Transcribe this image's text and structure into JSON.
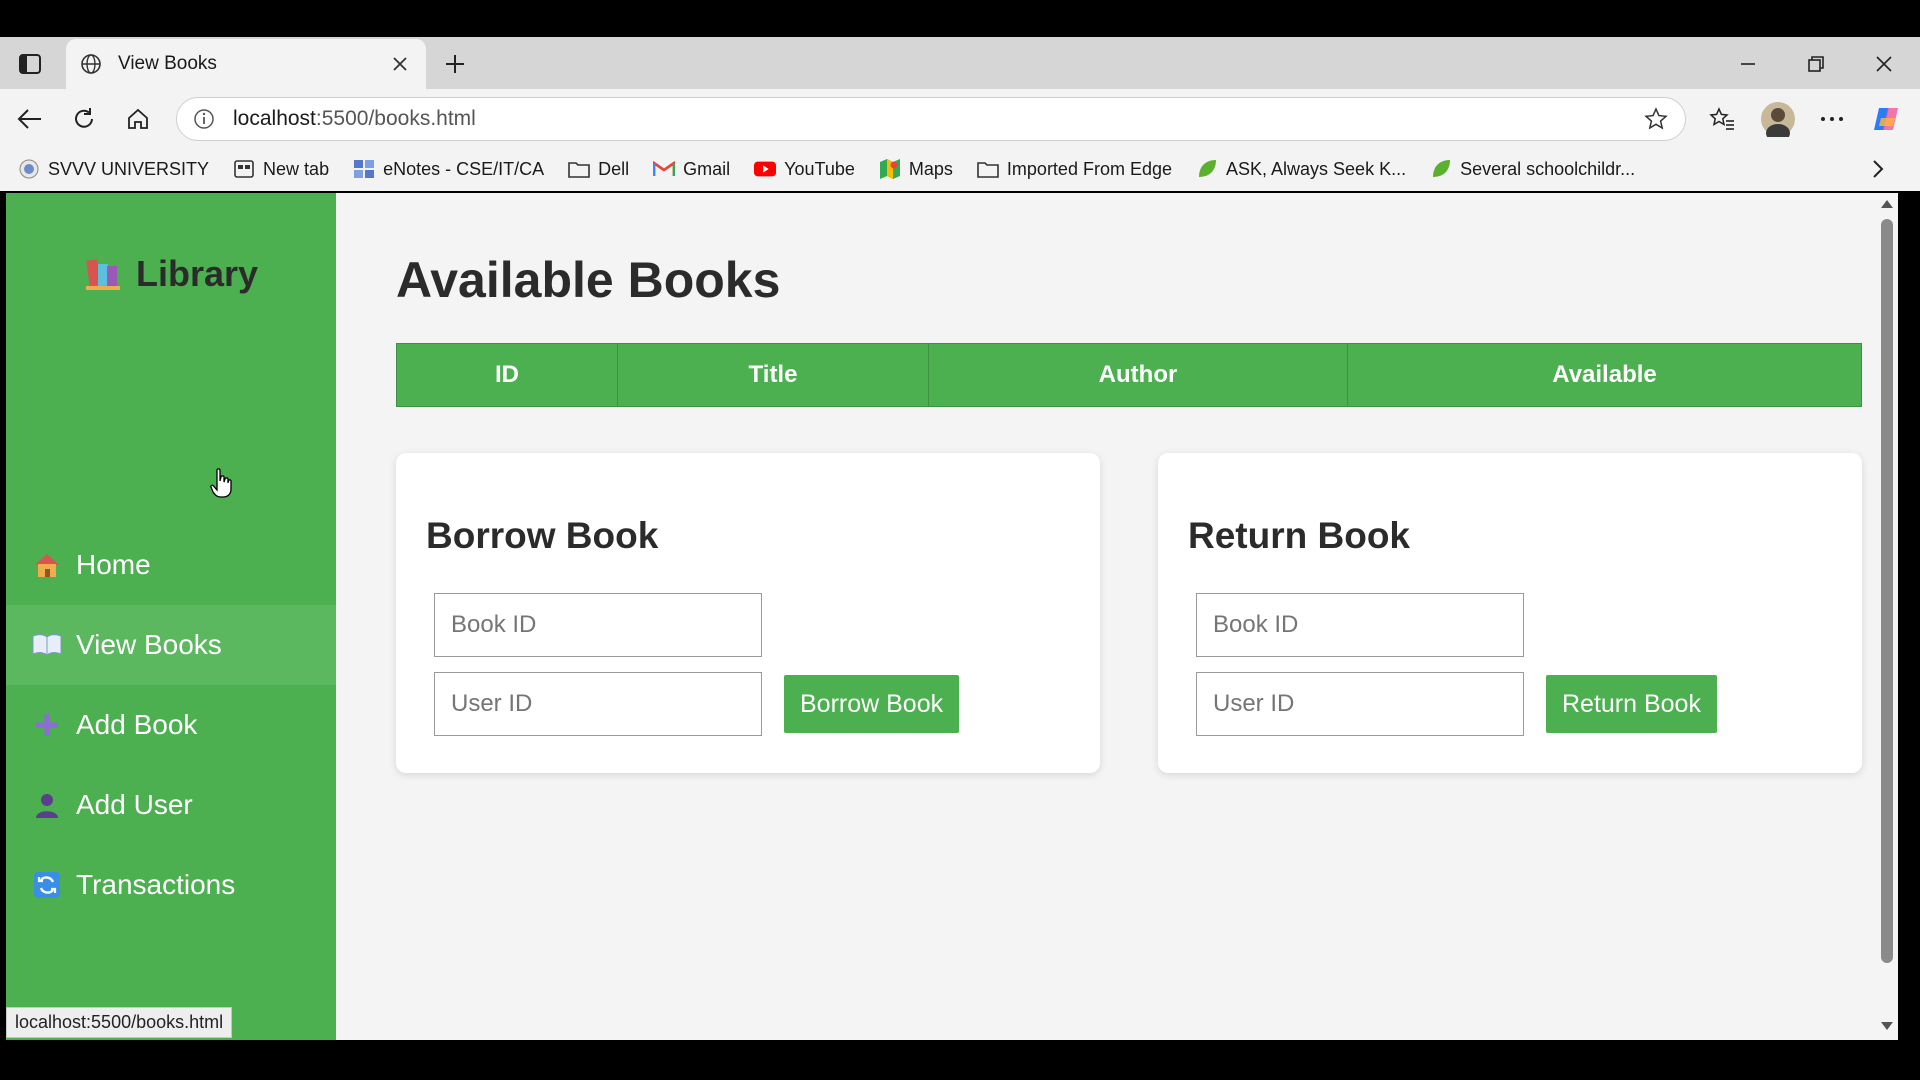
{
  "browser": {
    "tab_title": "View Books",
    "url_host": "localhost",
    "url_rest": ":5500/books.html",
    "status_url": "localhost:5500/books.html",
    "icons": {
      "tab_actions": "tab-actions-icon",
      "globe": "globe-icon",
      "close": "close-icon",
      "new_tab": "plus-icon",
      "minimize": "minimize-icon",
      "restore": "restore-icon",
      "window_close": "close-icon",
      "back": "back-arrow-icon",
      "refresh": "refresh-icon",
      "home": "home-icon",
      "info": "info-icon",
      "star": "star-icon",
      "favorites": "favorites-icon",
      "profile": "avatar",
      "more": "more-icon",
      "copilot": "copilot-icon"
    }
  },
  "bookmarks": [
    {
      "label": "SVVV UNIVERSITY",
      "icon": "university-icon"
    },
    {
      "label": "New tab",
      "icon": "newtab-icon"
    },
    {
      "label": "eNotes - CSE/IT/CA",
      "icon": "enotes-icon"
    },
    {
      "label": "Dell",
      "icon": "folder-icon"
    },
    {
      "label": "Gmail",
      "icon": "gmail-icon"
    },
    {
      "label": "YouTube",
      "icon": "youtube-icon"
    },
    {
      "label": "Maps",
      "icon": "maps-icon"
    },
    {
      "label": "Imported From Edge",
      "icon": "folder-icon"
    },
    {
      "label": "ASK, Always Seek K...",
      "icon": "leaf-icon"
    },
    {
      "label": "Several schoolchildr...",
      "icon": "leaf-icon"
    }
  ],
  "sidebar": {
    "brand": "Library",
    "items": [
      {
        "label": "Home",
        "icon": "home-icon"
      },
      {
        "label": "View Books",
        "icon": "book-icon"
      },
      {
        "label": "Add Book",
        "icon": "plus-icon"
      },
      {
        "label": "Add User",
        "icon": "user-icon"
      },
      {
        "label": "Transactions",
        "icon": "transactions-icon"
      }
    ],
    "active_index": 1
  },
  "main": {
    "title": "Available Books",
    "table_headers": [
      "ID",
      "Title",
      "Author",
      "Available"
    ],
    "borrow": {
      "heading": "Borrow Book",
      "book_id_placeholder": "Book ID",
      "user_id_placeholder": "User ID",
      "button": "Borrow Book"
    },
    "return": {
      "heading": "Return Book",
      "book_id_placeholder": "Book ID",
      "user_id_placeholder": "User ID",
      "button": "Return Book"
    }
  },
  "colors": {
    "accent_green": "#4caf50",
    "active_item": "#5cb85f",
    "page_bg": "#f4f4f4",
    "heading_text": "#2b2b2b"
  }
}
